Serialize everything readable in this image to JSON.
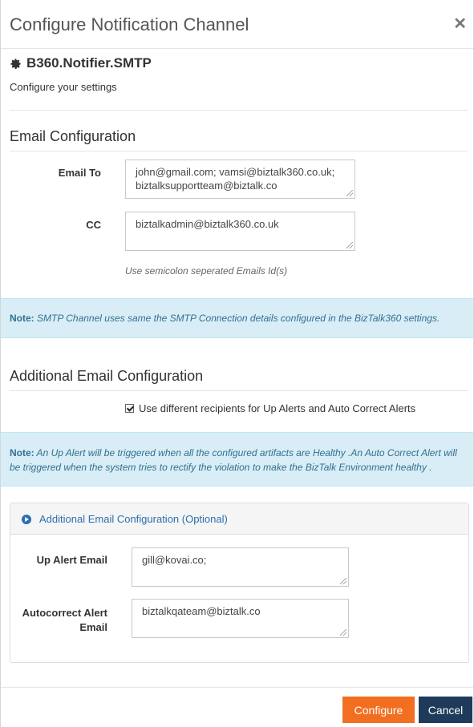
{
  "modal": {
    "title": "Configure Notification Channel"
  },
  "channel": {
    "icon": "gear-icon",
    "name": "B360.Notifier.SMTP",
    "subtitle": "Configure your settings"
  },
  "email_config": {
    "heading": "Email Configuration",
    "email_to_label": "Email To",
    "email_to_line1": "john@gmail.com; vamsi@biztalk360.co.uk;",
    "email_to_line2": "biztalksupportteam@biztalk.co",
    "cc_label": "CC",
    "cc_value": "biztalkadmin@biztalk360.co.uk",
    "help_text": "Use semicolon seperated Emails Id(s)"
  },
  "note1": {
    "prefix": "Note:",
    "text": " SMTP Channel uses same the SMTP Connection details configured in the BizTalk360 settings."
  },
  "additional": {
    "heading": "Additional Email Configuration",
    "checkbox_label": "Use different recipients for Up Alerts and Auto Correct Alerts",
    "checkbox_checked": true
  },
  "note2": {
    "prefix": "Note:",
    "text": " An Up Alert will be triggered when all the configured artifacts are Healthy .An Auto Correct Alert will be triggered when the system tries to rectify the violation to make the BizTalk Environment healthy ."
  },
  "optional_panel": {
    "title": "Additional Email Configuration (Optional)",
    "up_alert_label": "Up Alert Email",
    "up_alert_value": "gill@kovai.co;",
    "autocorrect_label_line1": "Autocorrect Alert",
    "autocorrect_label_line2": "Email",
    "autocorrect_value": "biztalkqateam@biztalk.co"
  },
  "footer": {
    "configure_label": "Configure",
    "cancel_label": "Cancel"
  },
  "colors": {
    "primary_button": "#f26f21",
    "secondary_button": "#1f3b5b",
    "note_background": "#d9edf7",
    "link": "#2a6fae"
  }
}
